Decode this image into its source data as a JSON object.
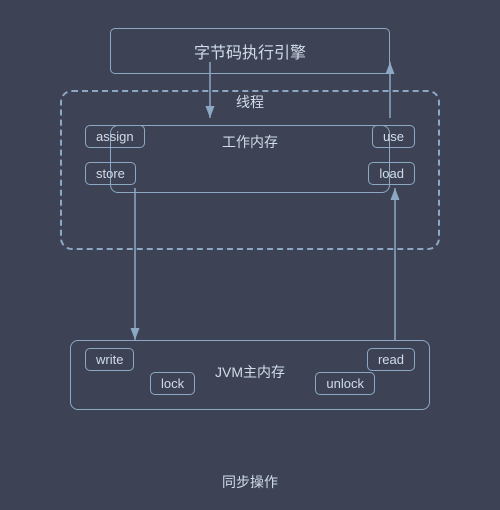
{
  "diagram": {
    "bytecode_label": "字节码执行引擎",
    "thread_label": "线程",
    "work_memory_label": "工作内存",
    "jvm_label": "JVM主内存",
    "sync_label": "同步操作",
    "boxes": {
      "assign": "assign",
      "use": "use",
      "store": "store",
      "load": "load",
      "write": "write",
      "read": "read",
      "lock": "lock",
      "unlock": "unlock"
    }
  }
}
